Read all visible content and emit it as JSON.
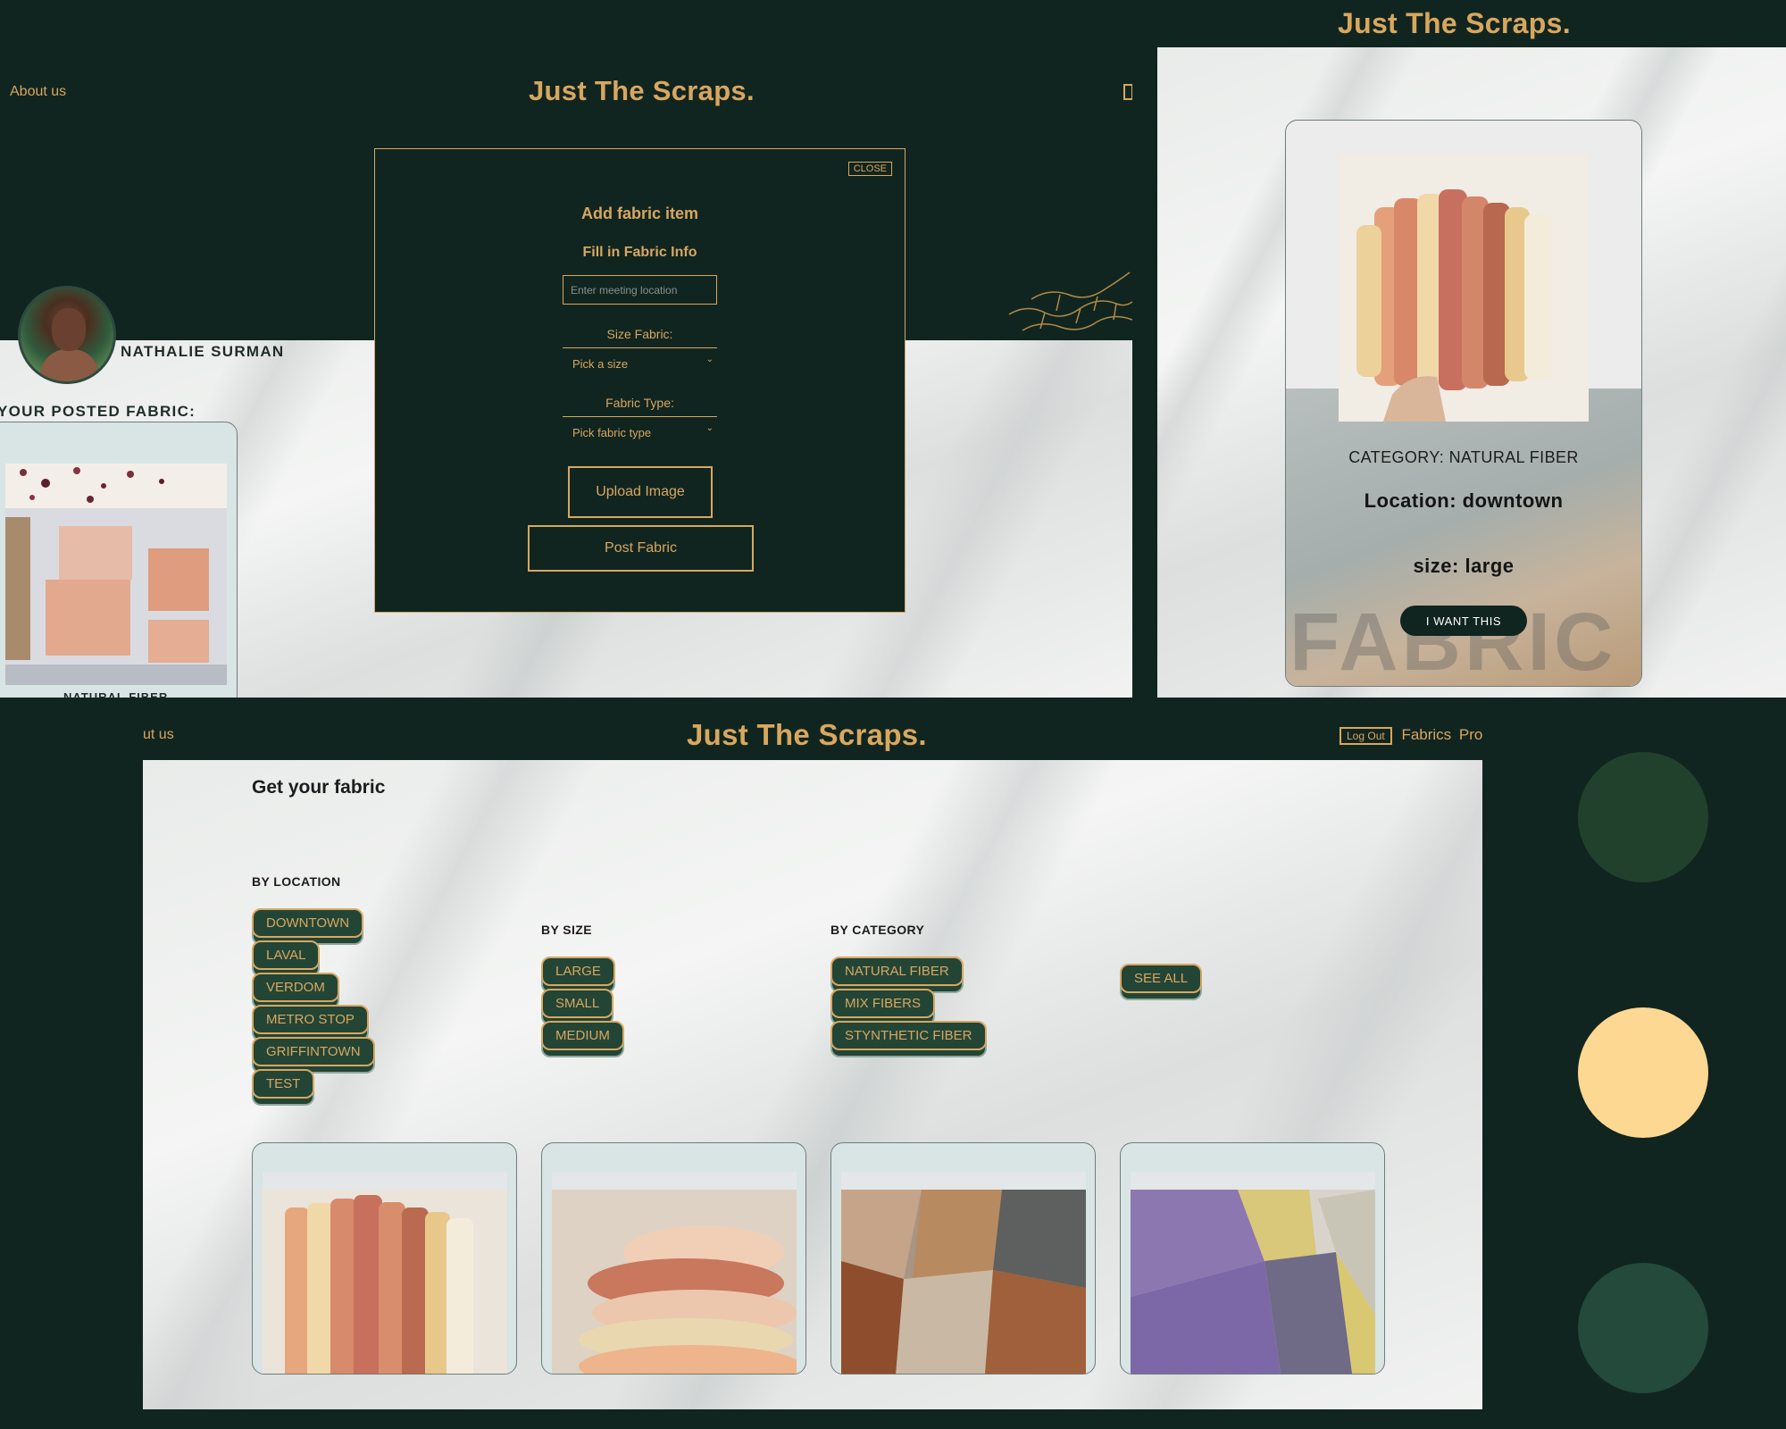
{
  "profile_view": {
    "nav": {
      "about": "About us",
      "brand": "Just The Scraps."
    },
    "profile": {
      "name": "NATHALIE SURMAN",
      "posted_label": "YOUR POSTED FABRIC:",
      "posted_card_label": "NATURAL FIBER"
    },
    "modal": {
      "close_label": "CLOSE",
      "title": "Add fabric item",
      "subtitle": "Fill in Fabric Info",
      "location_placeholder": "Enter meeting location",
      "size_label": "Size Fabric:",
      "size_selected": "Pick a size",
      "type_label": "Fabric Type:",
      "type_selected": "Pick fabric type",
      "upload_label": "Upload Image",
      "post_label": "Post Fabric"
    }
  },
  "detail_view": {
    "brand": "Just The Scraps.",
    "category": "CATEGORY: NATURAL FIBER",
    "location": "Location: downtown",
    "size": "size: large",
    "cta": "I WANT THIS",
    "watermark": "FABRIC"
  },
  "browse_view": {
    "nav": {
      "about": "ut us",
      "brand": "Just The Scraps.",
      "logout": "Log Out",
      "fabrics": "Fabrics",
      "profile": "Prof"
    },
    "title": "Get your fabric",
    "by_location": {
      "label": "BY LOCATION",
      "options": [
        "DOWNTOWN",
        "LAVAL",
        "VERDOM",
        "METRO STOP",
        "GRIFFINTOWN",
        "TEST"
      ]
    },
    "by_size": {
      "label": "BY SIZE",
      "options": [
        "LARGE",
        "SMALL",
        "MEDIUM"
      ]
    },
    "by_category": {
      "label": "BY CATEGORY",
      "options": [
        "NATURAL FIBER",
        "MIX FIBERS",
        "STYNTHETIC FIBER"
      ]
    },
    "see_all": "SEE ALL"
  },
  "palette": {
    "background": "#112520",
    "accent": "#d8a75e",
    "swatch_1": "#22412c",
    "swatch_2": "#fdd893",
    "swatch_3": "#234a3b"
  }
}
